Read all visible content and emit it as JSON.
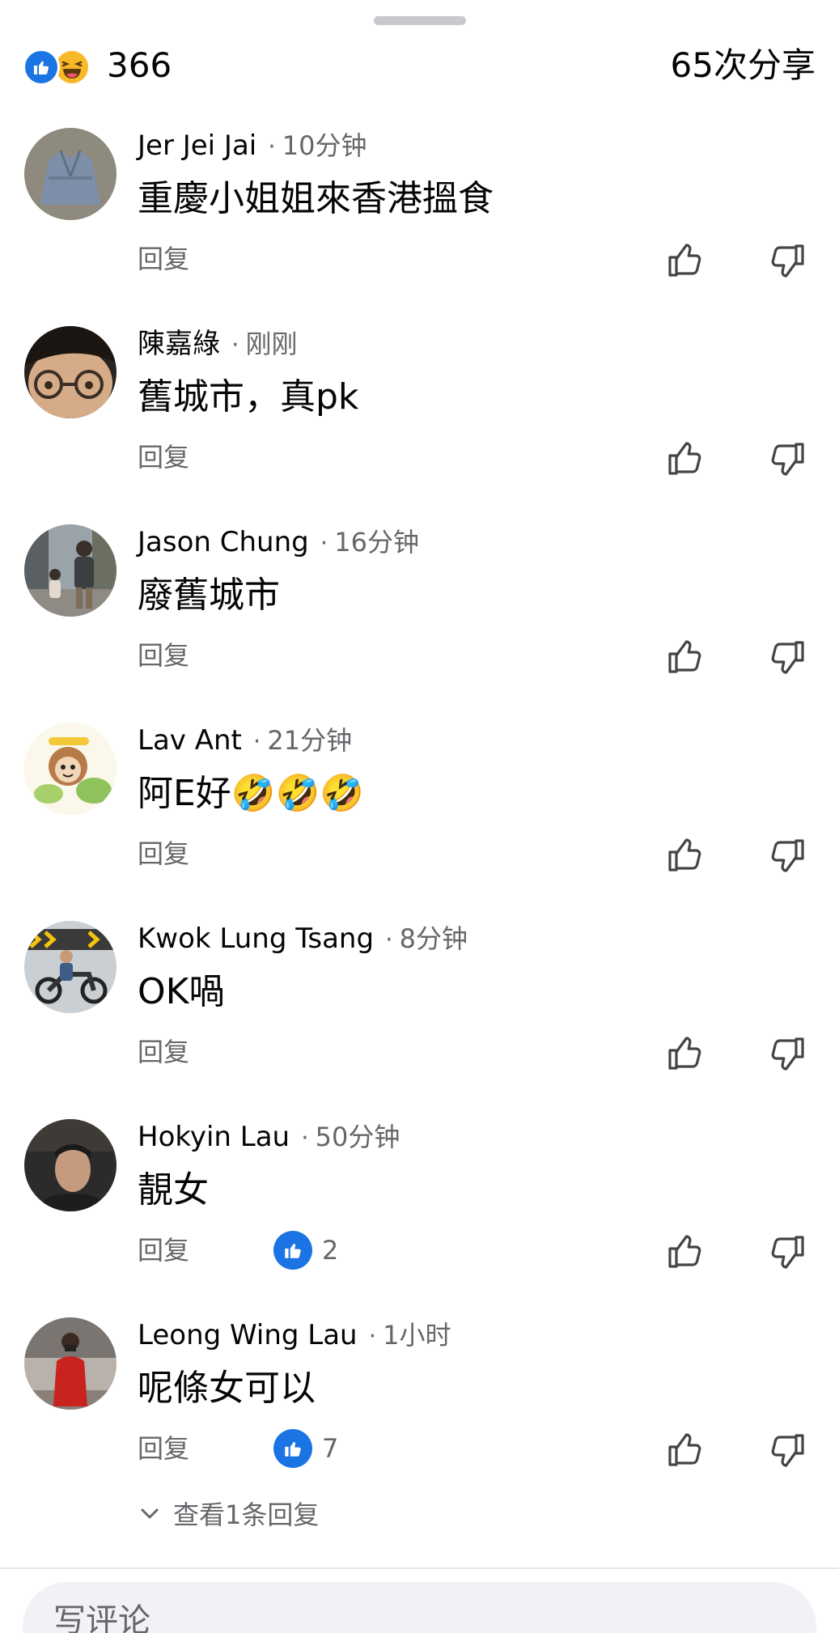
{
  "summary": {
    "reaction_count": "366",
    "share_count": "65次分享",
    "icons": [
      "like-icon",
      "haha-icon"
    ]
  },
  "comments": [
    {
      "author": "Jer Jei Jai",
      "time": "10分钟",
      "text": "重慶小姐姐來香港搵食",
      "reply": "回复",
      "likes": null,
      "avatar": "avatar-shirt"
    },
    {
      "author": "陳嘉綠",
      "time": "刚刚",
      "text": "舊城市，真pk",
      "reply": "回复",
      "likes": null,
      "avatar": "avatar-face-glasses"
    },
    {
      "author": "Jason Chung",
      "time": "16分钟",
      "text": "廢舊城市",
      "reply": "回复",
      "likes": null,
      "avatar": "avatar-street"
    },
    {
      "author": "Lav Ant",
      "time": "21分钟",
      "text": "阿E好",
      "emoji": "🤣🤣🤣",
      "reply": "回复",
      "likes": null,
      "avatar": "avatar-cartoon"
    },
    {
      "author": "Kwok Lung Tsang",
      "time": "8分钟",
      "text": "OK喎",
      "reply": "回复",
      "likes": null,
      "avatar": "avatar-motorbike"
    },
    {
      "author": "Hokyin Lau",
      "time": "50分钟",
      "text": "靚女",
      "reply": "回复",
      "likes": "2",
      "avatar": "avatar-man"
    },
    {
      "author": "Leong Wing Lau",
      "time": "1小时",
      "text": "呢條女可以",
      "reply": "回复",
      "likes": "7",
      "avatar": "avatar-red-jacket"
    }
  ],
  "view_replies": "查看1条回复",
  "composer": {
    "placeholder": "写评论"
  },
  "colors": {
    "accent": "#1b74e4",
    "secondary_text": "#65676b",
    "composer_bg": "#f0f2f5"
  }
}
